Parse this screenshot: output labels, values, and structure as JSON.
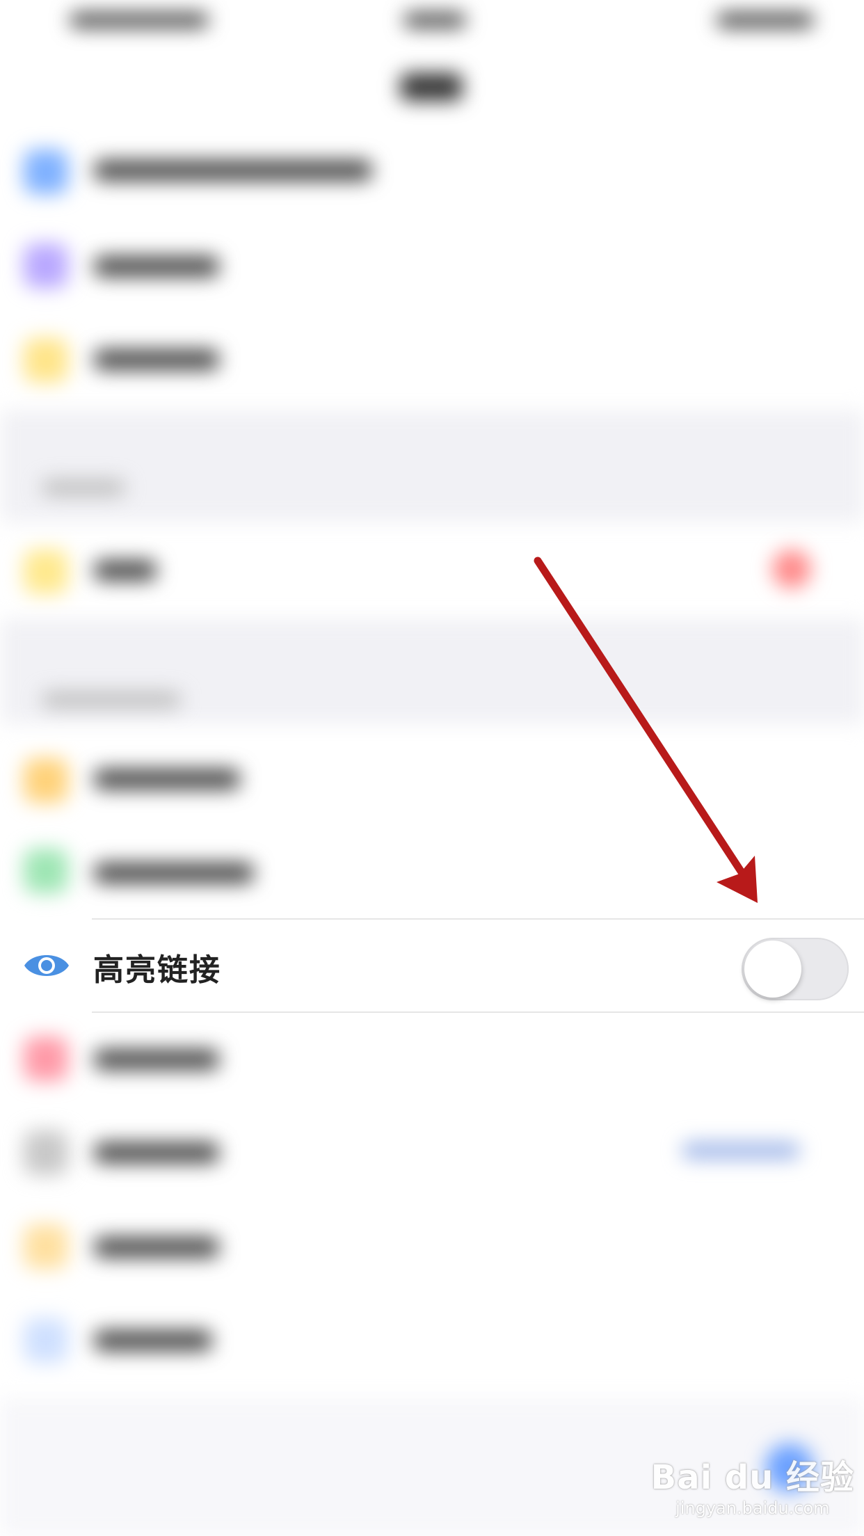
{
  "highlight_row": {
    "label": "高亮链接",
    "toggle_on": false,
    "icon": "eye-icon"
  },
  "watermark": {
    "brand": "Bai du 经验",
    "url": "jingyan.baidu.com"
  },
  "colors": {
    "accent": "#4a90e2",
    "arrow": "#b81a1a",
    "toggle_off": "#e9e9ec"
  }
}
